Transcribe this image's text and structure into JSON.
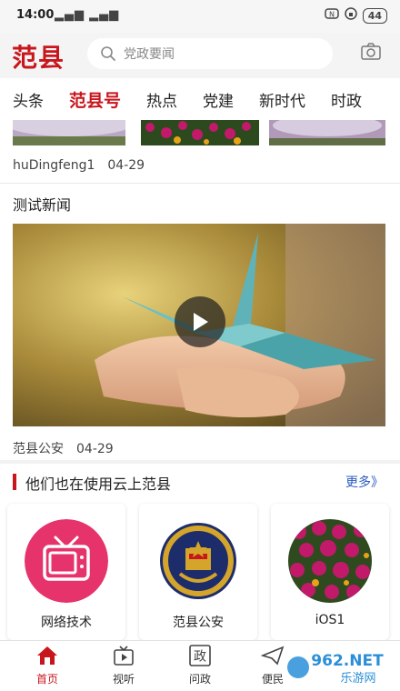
{
  "status": {
    "time": "14:00",
    "signal": "▂▄▆ ▂▄▆",
    "battery": "44"
  },
  "header": {
    "logo": "范县",
    "search_placeholder": "党政要闻"
  },
  "tabs": [
    {
      "label": "头条"
    },
    {
      "label": "范县号"
    },
    {
      "label": "热点"
    },
    {
      "label": "党建"
    },
    {
      "label": "新时代"
    },
    {
      "label": "时政"
    }
  ],
  "post1": {
    "author": "huDingfeng1",
    "date": "04-29"
  },
  "post2": {
    "title": "测试新闻",
    "source": "范县公安",
    "date": "04-29"
  },
  "section": {
    "title": "他们也在使用云上范县",
    "more": "更多》"
  },
  "cards": [
    {
      "label": "网络技术"
    },
    {
      "label": "范县公安"
    },
    {
      "label": "iOS1"
    }
  ],
  "bottom_nav": [
    {
      "label": "首页",
      "icon": "home-icon"
    },
    {
      "label": "视听",
      "icon": "tv-icon"
    },
    {
      "label": "问政",
      "icon": "zheng-icon",
      "glyph": "政"
    },
    {
      "label": "便民",
      "icon": "paper-plane-icon"
    }
  ],
  "watermark": {
    "line1": "962.NET",
    "line2": "乐游网"
  },
  "colors": {
    "brand": "#c8161d",
    "link": "#2a5bbd",
    "pink": "#e6336b"
  }
}
